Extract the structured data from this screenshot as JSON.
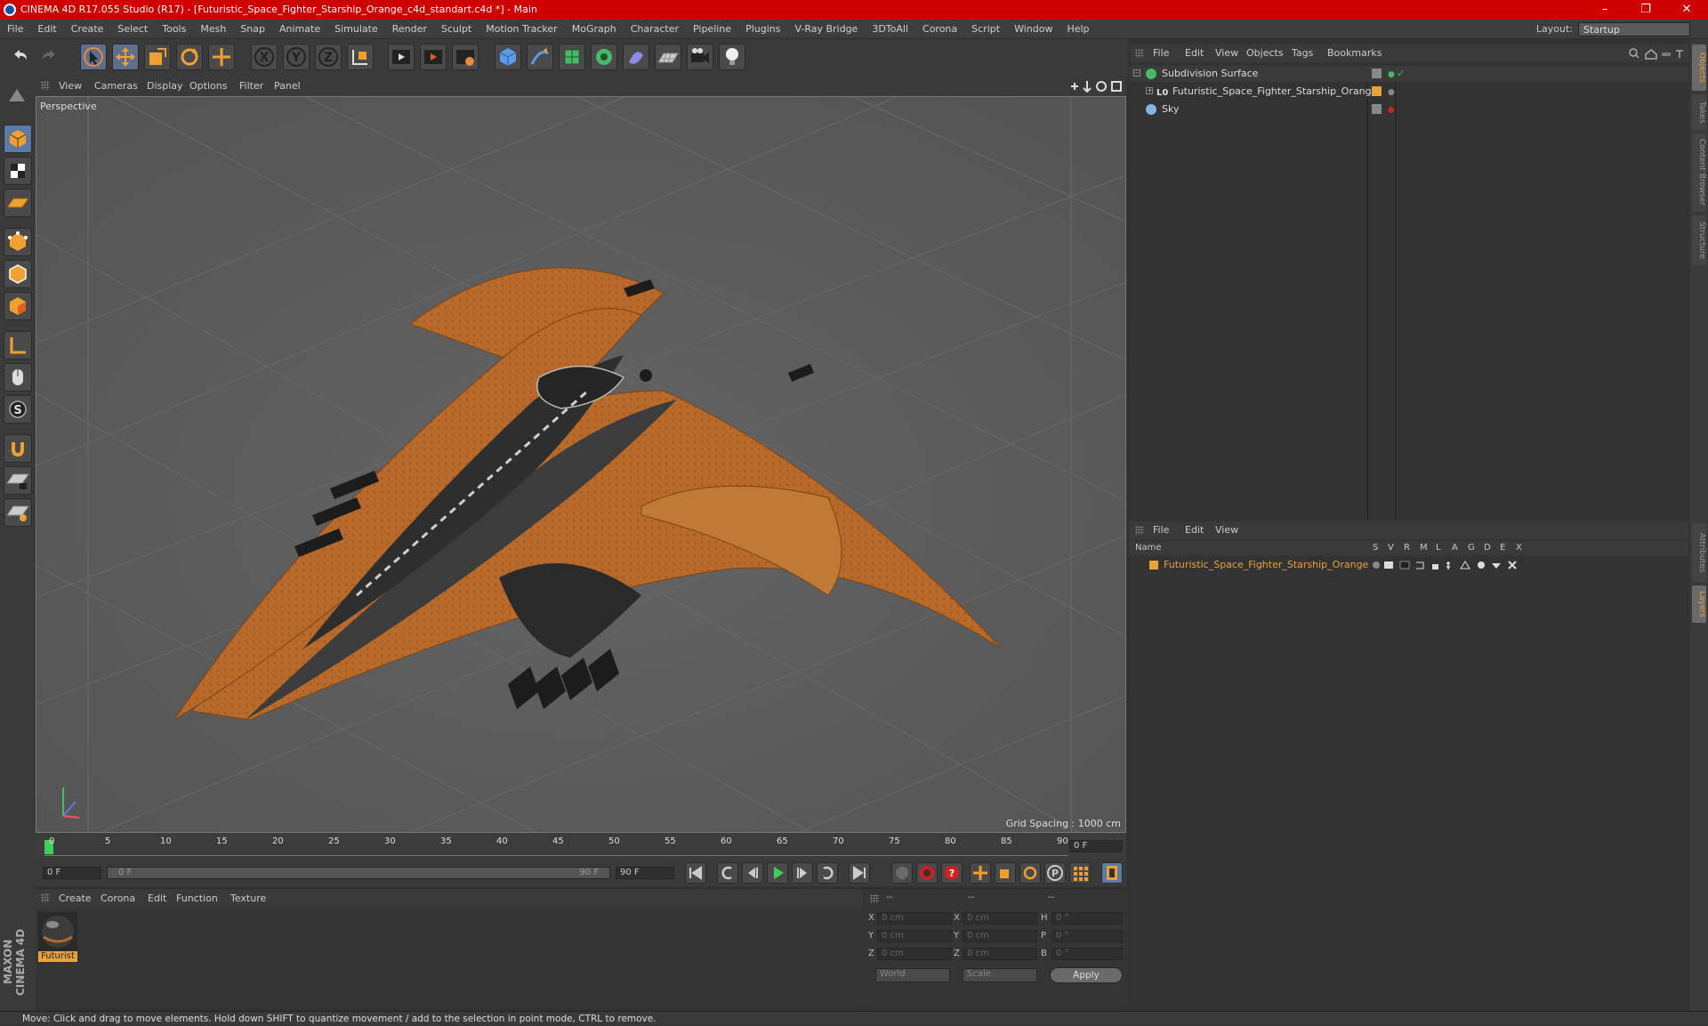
{
  "window": {
    "title": "CINEMA 4D R17.055 Studio (R17) - [Futuristic_Space_Fighter_Starship_Orange_c4d_standart.c4d *] - Main",
    "minimize": "–",
    "maximize": "❐",
    "close": "✕"
  },
  "menubar": {
    "items": [
      "File",
      "Edit",
      "Create",
      "Select",
      "Tools",
      "Mesh",
      "Snap",
      "Animate",
      "Simulate",
      "Render",
      "Sculpt",
      "Motion Tracker",
      "MoGraph",
      "Character",
      "Pipeline",
      "Plugins",
      "V-Ray Bridge",
      "3DToAll",
      "Corona",
      "Script",
      "Window",
      "Help"
    ],
    "layout_label": "Layout:",
    "layout_value": "Startup"
  },
  "viewport": {
    "menu": [
      "View",
      "Cameras",
      "Display",
      "Options",
      "Filter",
      "Panel"
    ],
    "label": "Perspective",
    "grid_spacing": "Grid Spacing : 1000 cm"
  },
  "timeline": {
    "ticks": [
      "0",
      "5",
      "10",
      "15",
      "20",
      "25",
      "30",
      "35",
      "40",
      "45",
      "50",
      "55",
      "60",
      "65",
      "70",
      "75",
      "80",
      "85",
      "90"
    ],
    "current_frame": "0 F",
    "start_field": "0 F",
    "range_start": "0 F",
    "range_end": "90 F",
    "end_field": "90 F"
  },
  "material_panel": {
    "menu": [
      "Create",
      "Corona",
      "Edit",
      "Function",
      "Texture"
    ],
    "material_name": "Futurist"
  },
  "coord_panel": {
    "header": [
      "--",
      "--",
      "--"
    ],
    "rows": [
      {
        "a": "X",
        "av": "0 cm",
        "b": "X",
        "bv": "0 cm",
        "c": "H",
        "cv": "0 °"
      },
      {
        "a": "Y",
        "av": "0 cm",
        "b": "Y",
        "bv": "0 cm",
        "c": "P",
        "cv": "0 °"
      },
      {
        "a": "Z",
        "av": "0 cm",
        "b": "Z",
        "bv": "0 cm",
        "c": "B",
        "cv": "0 °"
      }
    ],
    "world": "World",
    "scale": "Scale",
    "apply": "Apply"
  },
  "object_manager": {
    "menu": [
      "File",
      "Edit",
      "View",
      "Objects",
      "Tags",
      "Bookmarks"
    ],
    "objects": [
      {
        "name": "Subdivision Surface",
        "icon": "subdivision-icon"
      },
      {
        "name": "Futuristic_Space_Fighter_Starship_Orange",
        "icon": "null-icon"
      },
      {
        "name": "Sky",
        "icon": "sky-icon"
      }
    ]
  },
  "layer_manager": {
    "menu": [
      "File",
      "Edit",
      "View"
    ],
    "columns": [
      "Name",
      "S",
      "V",
      "R",
      "M",
      "L",
      "A",
      "G",
      "D",
      "E",
      "X"
    ],
    "layer_name": "Futuristic_Space_Fighter_Starship_Orange",
    "layer_color": "#e8a23c"
  },
  "right_tabs": [
    "Objects",
    "Takes",
    "Content Browser",
    "Structure",
    "Attributes",
    "Layers"
  ],
  "status": "Move: Click and drag to move elements. Hold down SHIFT to quantize movement / add to the selection in point mode, CTRL to remove.",
  "branding": "MAXON CINEMA 4D",
  "colors": {
    "accent": "#e8a23c",
    "title_bar": "#cf0000",
    "ship": "#b86a2a"
  }
}
